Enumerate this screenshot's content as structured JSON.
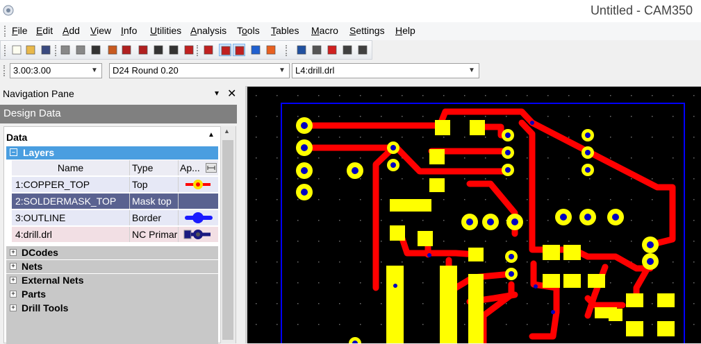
{
  "window": {
    "title": "Untitled - CAM350"
  },
  "menu": [
    {
      "label": "File",
      "u": "F",
      "rest": "ile"
    },
    {
      "label": "Edit",
      "u": "E",
      "rest": "dit"
    },
    {
      "label": "Add",
      "u": "A",
      "rest": "dd"
    },
    {
      "label": "View",
      "u": "V",
      "rest": "iew"
    },
    {
      "label": "Info",
      "u": "I",
      "rest": "nfo"
    },
    {
      "label": "Utilities",
      "u": "U",
      "rest": "tilities"
    },
    {
      "label": "Analysis",
      "u": "A",
      "rest": "nalysis",
      "pre": ""
    },
    {
      "label": "Tools",
      "pre": "T",
      "u": "o",
      "rest": "ols"
    },
    {
      "label": "Tables",
      "u": "T",
      "rest": "ables"
    },
    {
      "label": "Macro",
      "u": "M",
      "rest": "acro"
    },
    {
      "label": "Settings",
      "u": "S",
      "rest": "ettings"
    },
    {
      "label": "Help",
      "u": "H",
      "rest": "elp"
    }
  ],
  "toolbar": {
    "icons": [
      "new-file-icon",
      "open-folder-icon",
      "save-icon",
      "undo-icon",
      "redo-icon",
      "snapshot-icon",
      "print-icon",
      "zoom-window-icon",
      "zoom-out-icon",
      "zoom-all-icon",
      "layer-icon",
      "redraw-icon",
      "fit-icon",
      "add-layer-icon",
      "grid-icon",
      "grid-snap-icon",
      "color-icon",
      "highlight-icon",
      "move-icon",
      "copy-icon",
      "delete-icon",
      "rotate-icon",
      "mirror-icon"
    ]
  },
  "combos": {
    "grid": "3.00:3.00",
    "dcode": "D24  Round 0.20",
    "layer": "L4:drill.drl"
  },
  "nav": {
    "title": "Navigation Pane",
    "pin": "▾ ✕",
    "section_header": "Design Data",
    "data_title": "Data",
    "layers_label": "Layers",
    "columns": [
      "Name",
      "Type",
      "Ap..."
    ],
    "layers": [
      {
        "name": "1:COPPER_TOP",
        "type": "Top",
        "ap_color": "#ffe000"
      },
      {
        "name": "2:SOLDERMASK_TOP",
        "type": "Mask top",
        "ap_color": ""
      },
      {
        "name": "3:OUTLINE",
        "type": "Border",
        "ap_color": "#1a1aff"
      },
      {
        "name": "4:drill.drl",
        "type": "NC Primar",
        "ap_color": "#1a1a80"
      }
    ],
    "sections": [
      "DCodes",
      "Nets",
      "External Nets",
      "Parts",
      "Drill Tools"
    ]
  },
  "colors": {
    "copper": "#ff0000",
    "pad": "#ffff00",
    "drill": "#0000c0",
    "outline": "#0000ff",
    "background": "#000000"
  }
}
